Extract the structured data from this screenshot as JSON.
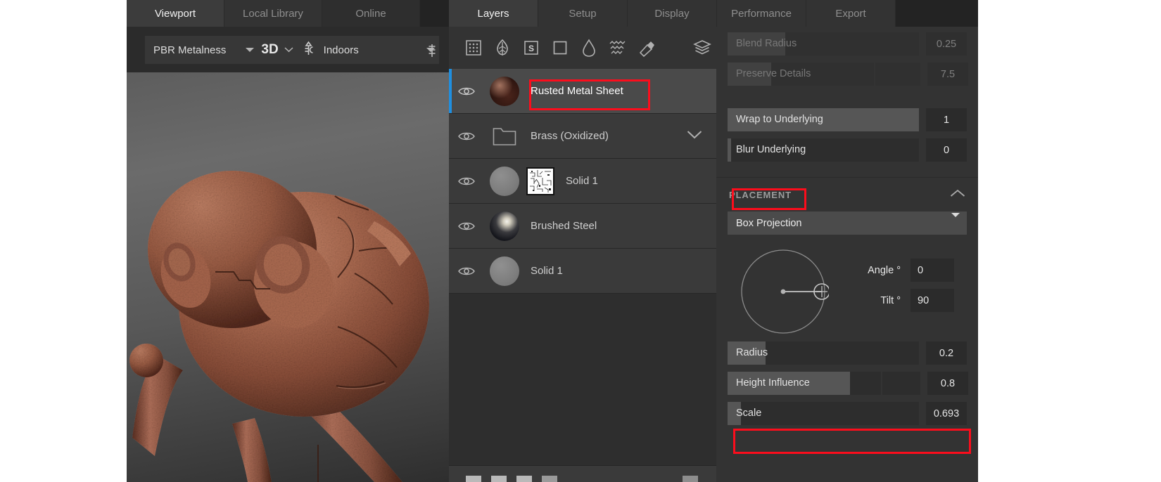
{
  "app": {
    "theme_bg": "#2b2b2b",
    "accent": "#1f8fe0",
    "annotation_color": "#fc0d1c"
  },
  "viewport_tabs": [
    {
      "label": "Viewport",
      "active": true
    },
    {
      "label": "Local Library",
      "active": false
    },
    {
      "label": "Online",
      "active": false
    }
  ],
  "panel_tabs": [
    {
      "label": "Layers",
      "active": true
    },
    {
      "label": "Setup",
      "active": false
    },
    {
      "label": "Display",
      "active": false
    },
    {
      "label": "Performance",
      "active": false
    },
    {
      "label": "Export",
      "active": false
    }
  ],
  "viewport_toolbar": {
    "shader": "PBR Metalness",
    "shader_icon": "caret-down-icon",
    "mode": "3D",
    "mode_icon": "chevron-down-icon",
    "lighting_icon": "environment-icon",
    "environment": "Indoors",
    "environment_icon": "caret-down-icon",
    "pin_icon": "pin-icon"
  },
  "viewport": {
    "model_description": "3D rusted metal creature model",
    "background": "studio-grey-gradient"
  },
  "layers_toolbar": {
    "icons": [
      "grid-pattern-icon",
      "leaf-icon",
      "smart-material-icon",
      "square-fill-icon",
      "droplet-icon",
      "waves-icon",
      "paint-brush-icon"
    ],
    "stack_icon": "layer-stack-icon"
  },
  "layers": [
    {
      "name": "Rusted Metal Sheet",
      "selected": true,
      "visible": true,
      "thumb": "rust-sphere",
      "type": "material",
      "has_mask": false,
      "has_group": false
    },
    {
      "name": "Brass (Oxidized)",
      "selected": false,
      "visible": true,
      "thumb": "folder",
      "type": "group",
      "has_mask": false,
      "has_group": true
    },
    {
      "name": "Solid 1",
      "selected": false,
      "visible": true,
      "thumb": "grey-sphere",
      "type": "fill",
      "has_mask": true,
      "has_group": false
    },
    {
      "name": "Brushed Steel",
      "selected": false,
      "visible": true,
      "thumb": "steel-sphere",
      "type": "material",
      "has_mask": false,
      "has_group": false
    },
    {
      "name": "Solid 1",
      "selected": false,
      "visible": true,
      "thumb": "grey-sphere",
      "type": "fill",
      "has_mask": false,
      "has_group": false
    }
  ],
  "layer_icons": {
    "eye": "eye-icon",
    "folder": "folder-icon",
    "chevron": "chevron-down-icon"
  },
  "properties": {
    "top_rows": [
      {
        "label": "Blend Radius",
        "value": "0.25",
        "fill_pct": 30,
        "faded": true,
        "extra_box": false
      },
      {
        "label": "Preserve Details",
        "value": "7.5",
        "fill_pct": 30,
        "faded": true,
        "extra_box": true
      }
    ],
    "mid_rows": [
      {
        "label": "Wrap to Underlying",
        "value": "1",
        "fill_pct": 100,
        "faded": false,
        "extra_box": false
      },
      {
        "label": "Blur Underlying",
        "value": "0",
        "fill_pct": 2,
        "faded": false,
        "extra_box": false
      }
    ],
    "placement": {
      "title": "PLACEMENT",
      "collapse_icon": "chevron-up-icon",
      "projection": "Box Projection",
      "projection_caret": "caret-down-icon",
      "dial": {
        "name": "angle-tilt-dial",
        "angle_deg": 0,
        "tilt_deg": 90
      },
      "angle_label": "Angle °",
      "angle_value": "0",
      "tilt_label": "Tilt °",
      "tilt_value": "90",
      "rows": [
        {
          "label": "Radius",
          "value": "0.2",
          "fill_pct": 20,
          "extra_box": false,
          "annotated": false
        },
        {
          "label": "Height Influence",
          "value": "0.8",
          "fill_pct": 80,
          "extra_box": true,
          "annotated": false
        },
        {
          "label": "Scale",
          "value": "0.693",
          "fill_pct": 7,
          "extra_box": false,
          "annotated": true
        }
      ]
    }
  },
  "annotations": [
    {
      "name": "annotation-layer-name",
      "target": "Rusted Metal Sheet"
    },
    {
      "name": "annotation-placement-header",
      "target": "PLACEMENT"
    },
    {
      "name": "annotation-scale-row",
      "target": "Scale 0.693"
    }
  ]
}
